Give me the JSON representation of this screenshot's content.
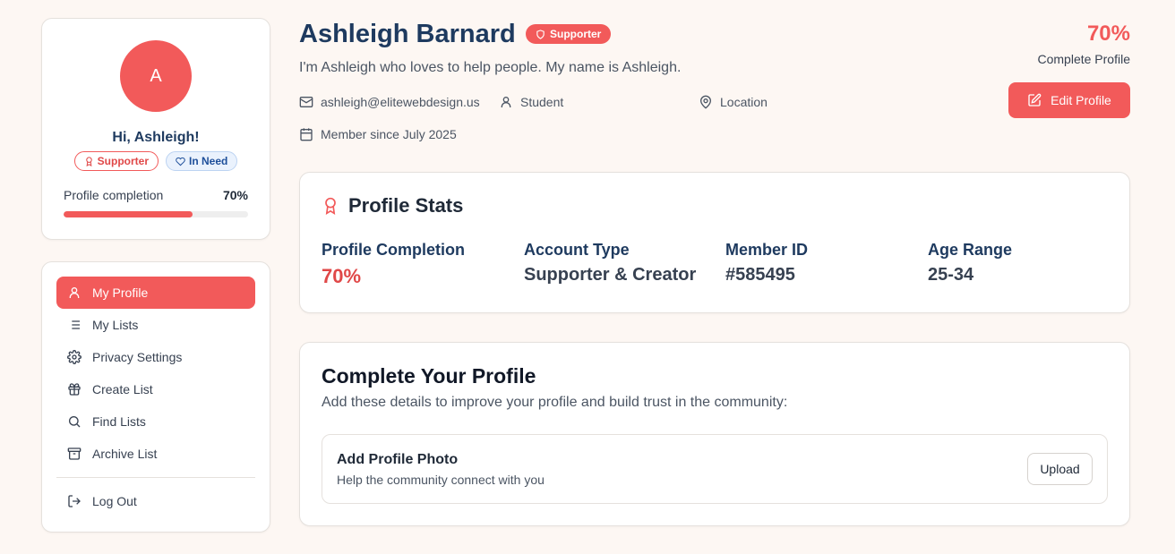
{
  "colors": {
    "accent": "#f25a5a",
    "navy": "#1e3a5f",
    "background": "#fdf7f3"
  },
  "sidebar": {
    "avatar_initial": "A",
    "greeting": "Hi, Ashleigh!",
    "badges": [
      {
        "label": "Supporter",
        "icon": "award-icon"
      },
      {
        "label": "In Need",
        "icon": "heart-icon"
      }
    ],
    "completion_label": "Profile completion",
    "completion_value": "70%",
    "completion_fraction": 0.7,
    "nav": [
      {
        "label": "My Profile",
        "icon": "user-icon",
        "active": true
      },
      {
        "label": "My Lists",
        "icon": "list-icon",
        "active": false
      },
      {
        "label": "Privacy Settings",
        "icon": "gear-icon",
        "active": false
      },
      {
        "label": "Create List",
        "icon": "gift-icon",
        "active": false
      },
      {
        "label": "Find Lists",
        "icon": "search-icon",
        "active": false
      },
      {
        "label": "Archive List",
        "icon": "archive-icon",
        "active": false
      }
    ],
    "logout_label": "Log Out"
  },
  "header": {
    "name": "Ashleigh Barnard",
    "badge": "Supporter",
    "bio": "I'm Ashleigh who loves to help people. My name is Ashleigh.",
    "email": "ashleigh@elitewebdesign.us",
    "role": "Student",
    "location": "Location",
    "member_since": "Member since July 2025",
    "completion_percent": "70%",
    "completion_label": "Complete Profile",
    "edit_label": "Edit Profile"
  },
  "stats": {
    "title": "Profile Stats",
    "items": [
      {
        "label": "Profile Completion",
        "value": "70%"
      },
      {
        "label": "Account Type",
        "value": "Supporter & Creator"
      },
      {
        "label": "Member ID",
        "value": "#585495"
      },
      {
        "label": "Age Range",
        "value": "25-34"
      }
    ]
  },
  "complete": {
    "title": "Complete Your Profile",
    "subtitle": "Add these details to improve your profile and build trust in the community:",
    "task": {
      "title": "Add Profile Photo",
      "subtitle": "Help the community connect with you",
      "button": "Upload"
    }
  }
}
